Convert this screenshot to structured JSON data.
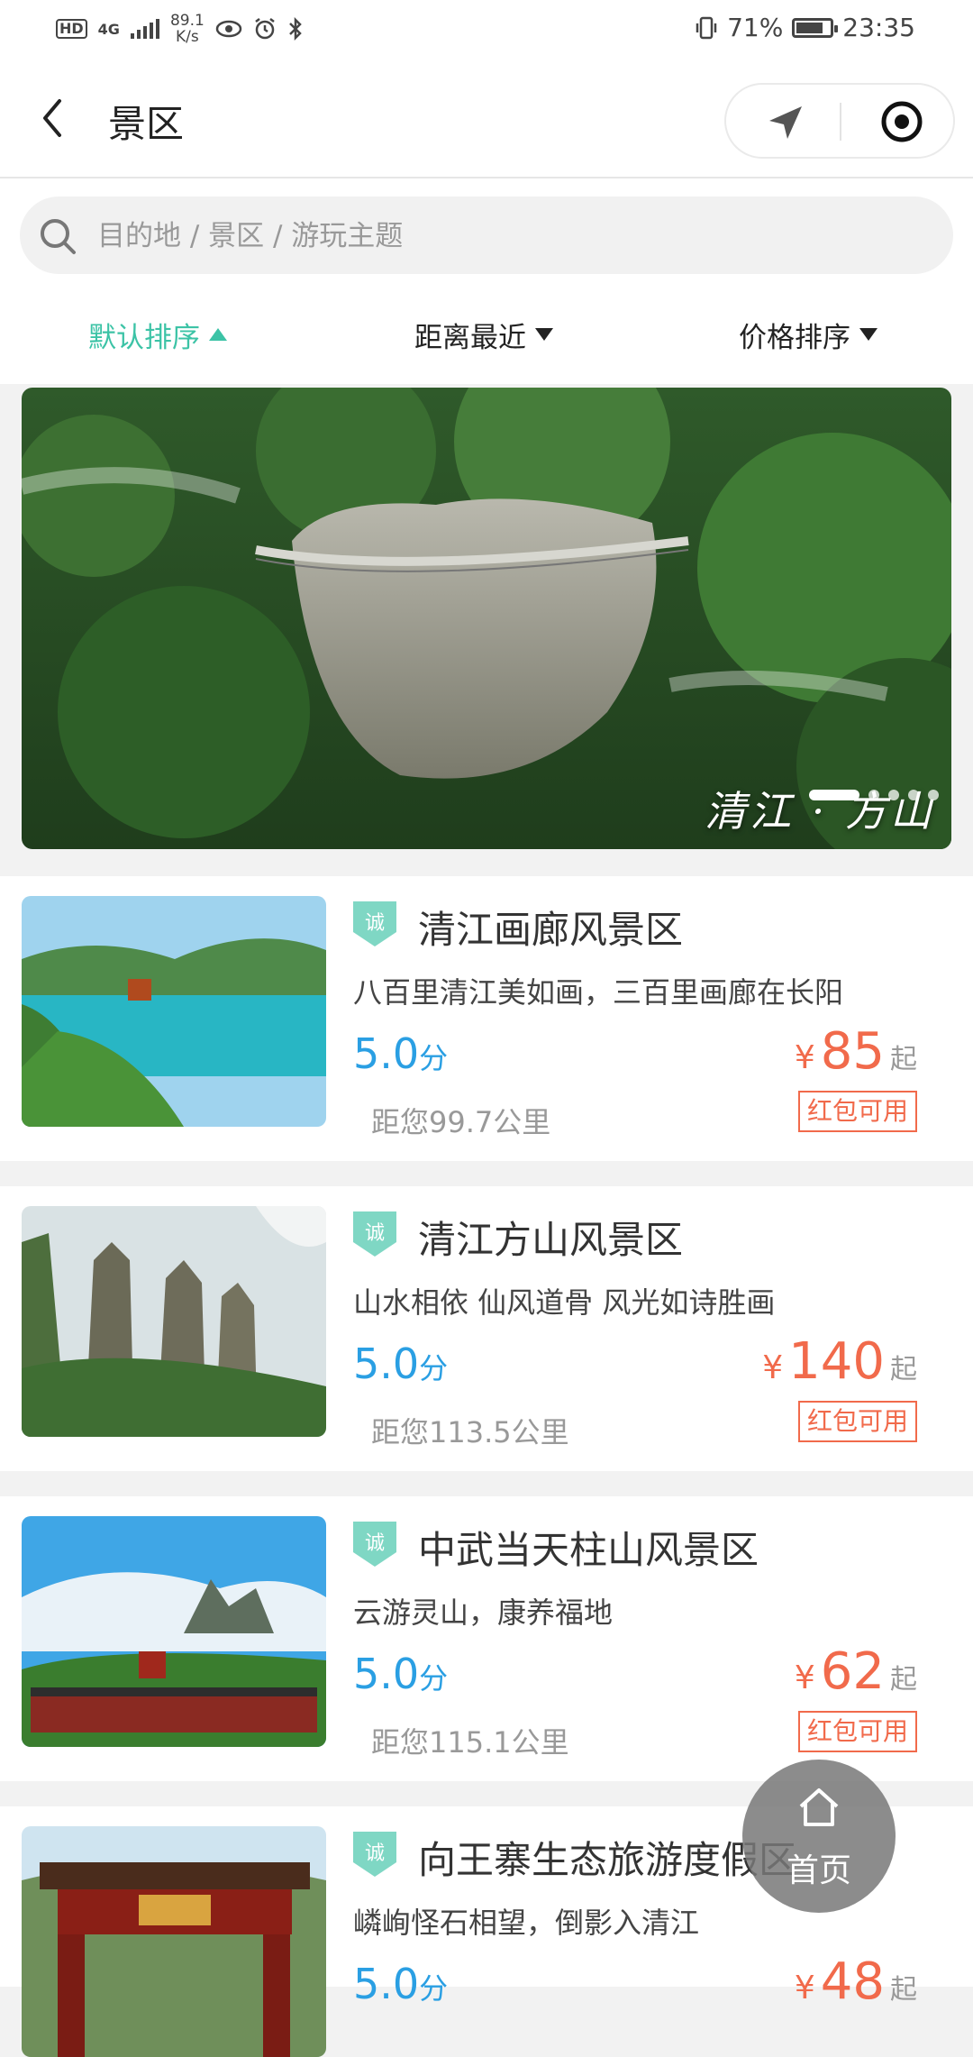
{
  "status_bar": {
    "hd": "HD",
    "net_type": "4G",
    "net_speed_top": "89.1",
    "net_speed_bottom": "K/s",
    "battery": "71%",
    "time": "23:35"
  },
  "nav": {
    "title": "景区"
  },
  "search": {
    "placeholder": "目的地 / 景区 / 游玩主题"
  },
  "sort": {
    "default": "默认排序",
    "distance": "距离最近",
    "price": "价格排序"
  },
  "banner": {
    "caption": "清江 · 方山",
    "slides": 5,
    "active_slide": 1
  },
  "spots": [
    {
      "badge": "诚",
      "name": "清江画廊风景区",
      "desc": "八百里清江美如画，三百里画廊在长阳",
      "score": "5.0",
      "score_unit": "分",
      "yen": "¥",
      "price": "85",
      "price_suffix": "起",
      "coupon": "红包可用",
      "distance": "距您99.7公里"
    },
    {
      "badge": "诚",
      "name": "清江方山风景区",
      "desc": "山水相依 仙风道骨 风光如诗胜画",
      "score": "5.0",
      "score_unit": "分",
      "yen": "¥",
      "price": "140",
      "price_suffix": "起",
      "coupon": "红包可用",
      "distance": "距您113.5公里"
    },
    {
      "badge": "诚",
      "name": "中武当天柱山风景区",
      "desc": "云游灵山，康养福地",
      "score": "5.0",
      "score_unit": "分",
      "yen": "¥",
      "price": "62",
      "price_suffix": "起",
      "coupon": "红包可用",
      "distance": "距您115.1公里"
    },
    {
      "badge": "诚",
      "name": "向王寨生态旅游度假区",
      "desc": "嶙峋怪石相望，倒影入清江",
      "score": "5.0",
      "score_unit": "分",
      "yen": "¥",
      "price": "48",
      "price_suffix": "起"
    }
  ],
  "home_button": {
    "label": "首页"
  },
  "colors": {
    "accent_green": "#3cc3a6",
    "score_blue": "#2a9fe3",
    "price_orange": "#f16a4b"
  }
}
